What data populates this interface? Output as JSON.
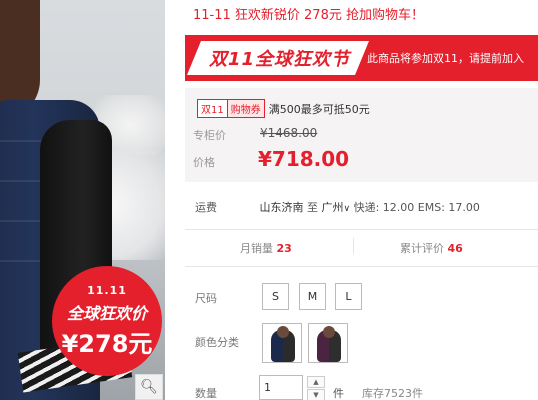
{
  "promo": {
    "headline": "11-11 狂欢新锐价 278元 抢加购物车！"
  },
  "badge": {
    "line1": "11.11",
    "line2": "全球狂欢价",
    "price": "¥278元"
  },
  "banner": {
    "logo": "双11全球狂欢节",
    "note": "此商品将参加双11，请提前加入"
  },
  "coupon": {
    "tag1": "双11",
    "tag2": "购物券",
    "text": "满500最多可抵50元"
  },
  "price": {
    "original_label": "专柜价",
    "original_value": "¥1468.00",
    "current_label": "价格",
    "current_value": "¥718.00"
  },
  "shipping": {
    "label": "运费",
    "origin": "山东济南",
    "to": "至",
    "destination": "广州",
    "rates": "快递: 12.00 EMS: 17.00"
  },
  "stats": {
    "sales_label": "月销量",
    "sales_value": "23",
    "reviews_label": "累计评价",
    "reviews_value": "46"
  },
  "size": {
    "label": "尺码",
    "options": [
      "S",
      "M",
      "L"
    ]
  },
  "color": {
    "label": "颜色分类"
  },
  "quantity": {
    "label": "数量",
    "value": "1",
    "unit": "件",
    "stock": "库存7523件"
  },
  "icons": {
    "zoom": "magnifier-icon",
    "chevron": "chevron-down-icon"
  },
  "colors": {
    "accent": "#e4202d",
    "price_box_bg": "#f5f3f3"
  }
}
